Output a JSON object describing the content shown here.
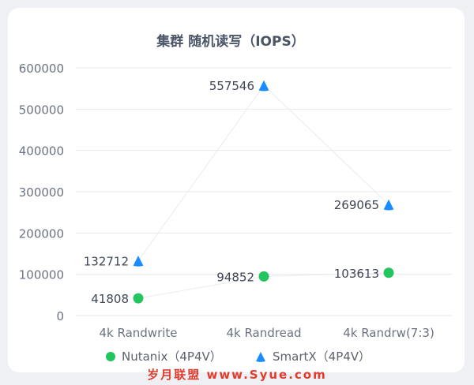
{
  "chart_data": {
    "type": "scatter",
    "title": "集群 随机读写（IOPS）",
    "categories": [
      "4k Randwrite",
      "4k Randread",
      "4k Randrw(7:3)"
    ],
    "series": [
      {
        "name": "Nutanix（4P4V）",
        "values": [
          41808,
          94852,
          103613
        ],
        "color": "#22c55e",
        "marker": "circle"
      },
      {
        "name": "SmartX（4P4V）",
        "values": [
          132712,
          557546,
          269065
        ],
        "color": "#1a8cff",
        "marker": "triangle"
      }
    ],
    "y_ticks": [
      0,
      100000,
      200000,
      300000,
      400000,
      500000,
      600000
    ],
    "ylim": [
      0,
      600000
    ],
    "grid": true,
    "legend_position": "bottom"
  },
  "watermark": "岁月联盟 www.Syue.com"
}
